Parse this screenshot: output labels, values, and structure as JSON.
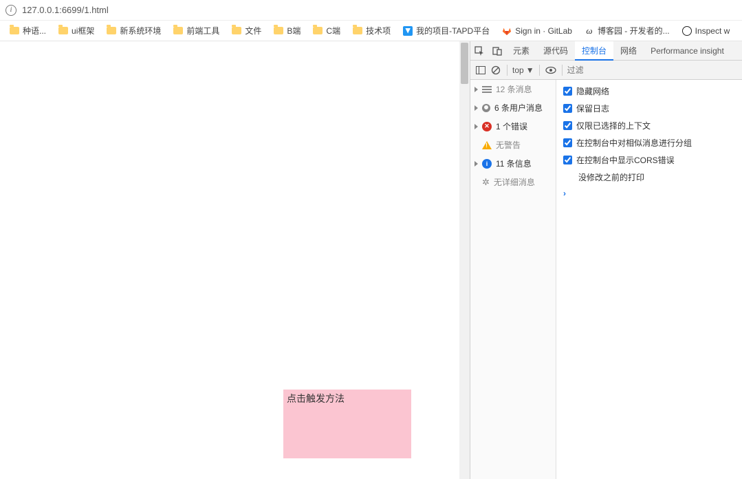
{
  "urlbar": {
    "url": "127.0.0.1:6699/1.html"
  },
  "bookmarks": [
    {
      "label": "种语...",
      "icon": "folder"
    },
    {
      "label": "ui框架",
      "icon": "folder"
    },
    {
      "label": "新系统环境",
      "icon": "folder"
    },
    {
      "label": "前端工具",
      "icon": "folder"
    },
    {
      "label": "文件",
      "icon": "folder"
    },
    {
      "label": "B端",
      "icon": "folder"
    },
    {
      "label": "C端",
      "icon": "folder"
    },
    {
      "label": "技术项",
      "icon": "folder"
    },
    {
      "label": "我的项目-TAPD平台",
      "icon": "tapd"
    },
    {
      "label": "Sign in · GitLab",
      "icon": "gitlab"
    },
    {
      "label": "博客园 - 开发者的...",
      "icon": "blog"
    },
    {
      "label": "Inspect w",
      "icon": "react"
    }
  ],
  "page": {
    "pink_box_text": "点击触发方法"
  },
  "devtools": {
    "tabs": {
      "t0": "元素",
      "t1": "源代码",
      "t2": "控制台",
      "t3": "网络",
      "t4": "Performance insight"
    },
    "toolbar": {
      "scope": "top",
      "filter_placeholder": "过滤"
    },
    "messages": {
      "all": "12 条消息",
      "user": "6 条用户消息",
      "error": "1 个错误",
      "warning": "无警告",
      "info": "11 条信息",
      "verbose": "无详细消息"
    },
    "settings": {
      "hide_network": "隐藏网络",
      "preserve_log": "保留日志",
      "selected_context_only": "仅限已选择的上下文",
      "group_similar": "在控制台中对相似消息进行分组",
      "show_cors": "在控制台中显示CORS错误"
    },
    "log_line": "没修改之前的打印",
    "prompt": ">"
  }
}
